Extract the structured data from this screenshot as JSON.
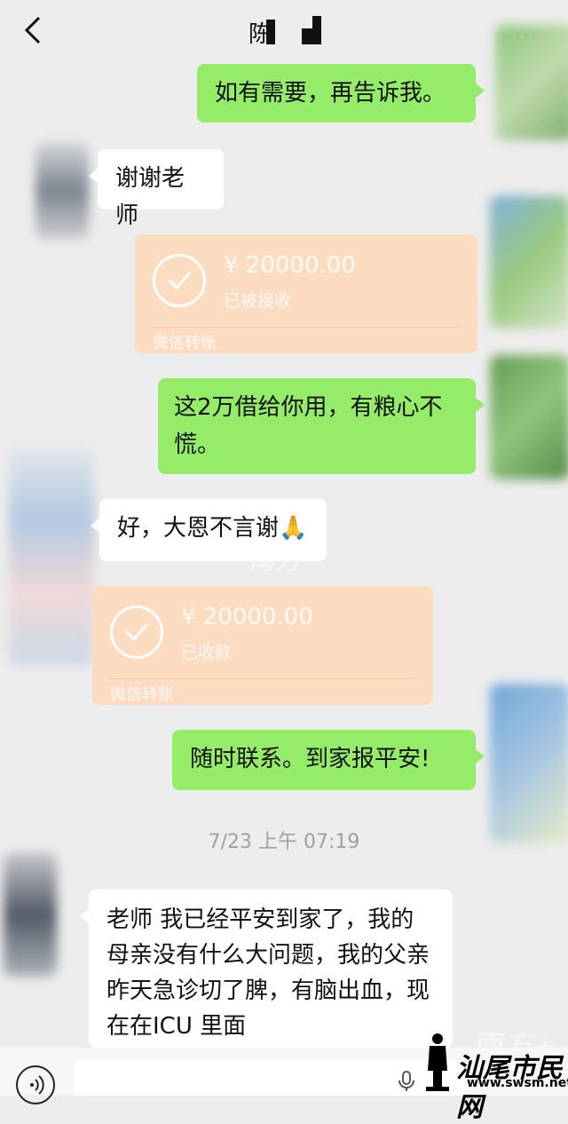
{
  "header": {
    "title": "陈",
    "more": "···"
  },
  "messages": [
    {
      "type": "text",
      "side": "right",
      "text": "如有需要，再告诉我。"
    },
    {
      "type": "text",
      "side": "left",
      "text": "谢谢老师"
    },
    {
      "type": "transfer",
      "side": "right",
      "amount": "¥ 20000.00",
      "status": "已被接收",
      "label": "微信转账"
    },
    {
      "type": "text",
      "side": "right",
      "text": "这2万借给你用，有粮心不慌。"
    },
    {
      "type": "text",
      "side": "left",
      "text": "好，大恩不言谢🙏"
    },
    {
      "type": "transfer",
      "side": "left",
      "amount": "¥ 20000.00",
      "status": "已收款",
      "label": "微信转账"
    },
    {
      "type": "text",
      "side": "right",
      "text": "随时联系。到家报平安!"
    },
    {
      "type": "text",
      "side": "left",
      "text": "老师 我已经平安到家了，我的母亲没有什么大问题，我的父亲昨天急诊切了脾，有脑出血，现在在ICU 里面"
    }
  ],
  "timestamp": "7/23 上午 07:19",
  "watermarks": [
    "南方",
    "南方+"
  ],
  "site_logo": {
    "name": "汕尾市民网",
    "url": "www.swsm.net"
  },
  "colors": {
    "background": "#ededed",
    "sent_bubble": "#95ec69",
    "received_bubble": "#ffffff",
    "transfer_card": "#fbdcc0"
  },
  "icons": [
    "back-icon",
    "more-icon",
    "check-circle-icon",
    "voice-icon",
    "mic-icon"
  ]
}
